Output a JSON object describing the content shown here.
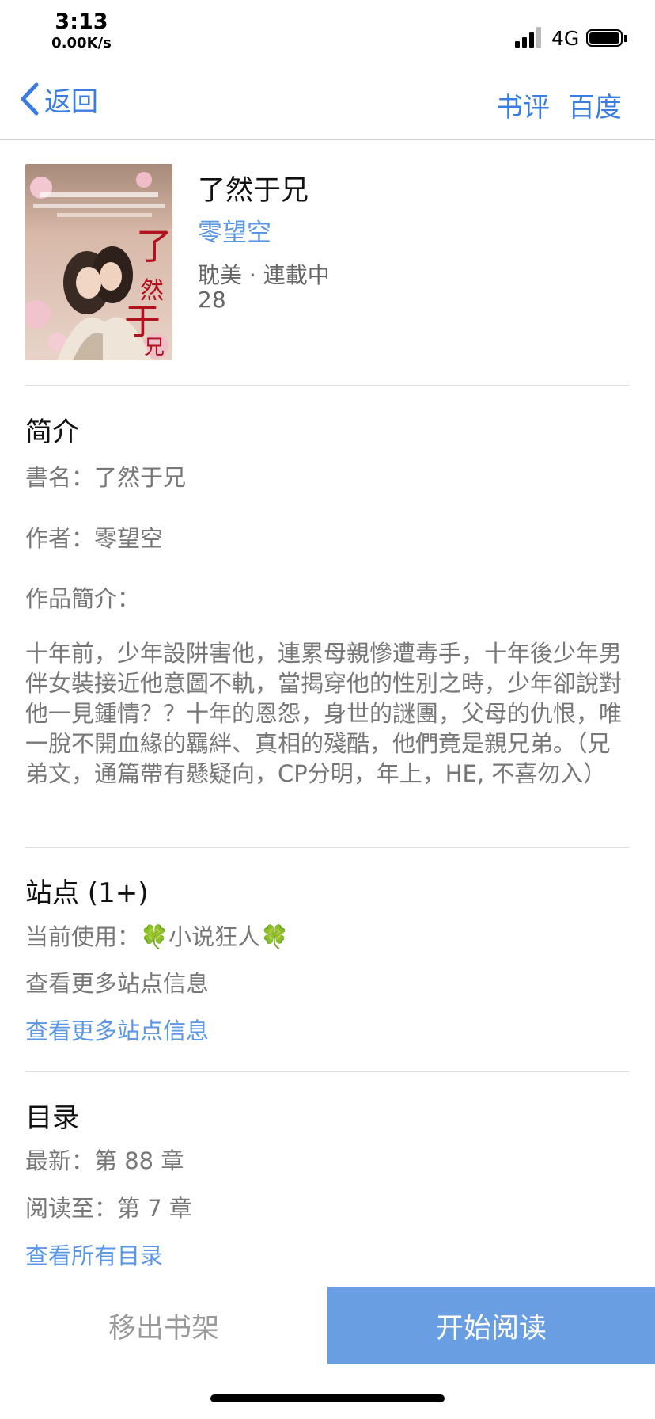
{
  "status_bar": {
    "time": "3:13",
    "speed": "0.00K/s",
    "network": "4G"
  },
  "nav": {
    "back_label": "返回",
    "actions": {
      "review": "书评",
      "baidu": "百度"
    }
  },
  "book": {
    "title": "了然于兄",
    "author": "零望空",
    "genre_status": "耽美 · 連載中",
    "count": "28",
    "cover_icon": "book-cover-image"
  },
  "intro": {
    "heading": "简介",
    "name_line": "書名：了然于兄",
    "author_line": "作者：零望空",
    "synopsis_label": "作品簡介：",
    "synopsis": "十年前，少年設阱害他，連累母親慘遭毒手，十年後少年男伴女裝接近他意圖不軌，當揭穿他的性別之時，少年卻說對他一見鍾情？？十年的恩怨，身世的謎團，父母的仇恨，唯一脫不開血緣的羈絆、真相的殘酷，他們竟是親兄弟。（兄弟文，通篇帶有懸疑向，CP分明，年上，HE, 不喜勿入）"
  },
  "sites": {
    "heading": "站点 (1+)",
    "current_label": "当前使用：",
    "current_site": "🍀小说狂人🍀",
    "info_text": "查看更多站点信息",
    "info_link": "查看更多站点信息"
  },
  "toc": {
    "heading": "目录",
    "latest": "最新：第 88 章",
    "read_to": "阅读至：第 7 章",
    "link": "查看所有目录"
  },
  "actions": {
    "remove": "移出书架",
    "read": "开始阅读"
  },
  "colors": {
    "accent": "#3b7ce0",
    "link": "#5b97e4",
    "read_button": "#6a9ee3"
  }
}
